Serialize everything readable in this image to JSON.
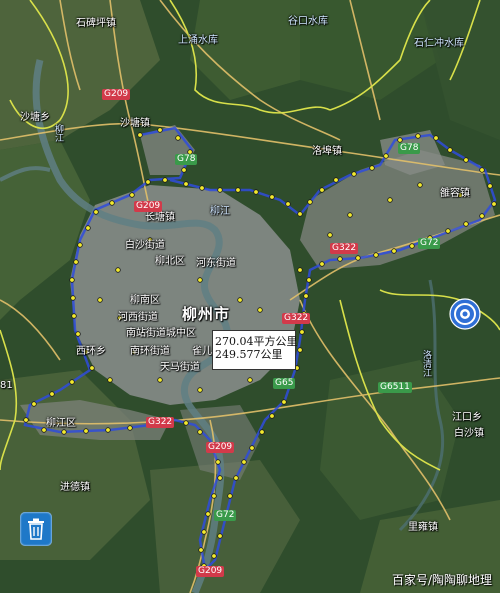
{
  "map": {
    "labels": {
      "shijiangzhen": "石碑坪镇",
      "shangdu": "上涌水库",
      "gukou": "谷口水库",
      "shiren": "石仁冲水库",
      "sheshan": "沙塘乡",
      "liujiang_river": "柳江",
      "shatang_town": "沙塘镇",
      "luodun": "洛埠镇",
      "changtang": "长塘镇",
      "liujiang_river2": "柳江",
      "liubei": "柳北区",
      "baishi": "白沙街道",
      "hedong": "河东街道",
      "liunan": "柳南区",
      "hexi": "河西街道",
      "nanzhan": "南站街道",
      "chengzhong": "城中区",
      "nanhuan": "南环街道",
      "queer": "雀儿山",
      "tianma": "天马街道",
      "xihuan": "西环乡",
      "city": "柳州市",
      "liujiang_district": "柳江区",
      "jinjin": "进德镇",
      "lirong": "雒容镇",
      "jiangkou": "江口乡",
      "baisha": "白沙镇",
      "luoqing": "洛清江",
      "liyong": "里雍镇",
      "left_number": "81"
    },
    "roads": {
      "g209_top": "G209",
      "g209_mid": "G209",
      "g78_left": "G78",
      "g78_right": "G78",
      "g322_right": "G322",
      "g72_right": "G72",
      "g322_center": "G322",
      "g65": "G65",
      "g6511": "G6511",
      "g322_left": "G322",
      "g209_south": "G209",
      "g72_south": "G72",
      "g209_bottom": "G209"
    },
    "area": {
      "line1": "270.04平方公里",
      "line2": "249.577公里"
    },
    "watermark": "百家号/陶陶聊地理"
  }
}
